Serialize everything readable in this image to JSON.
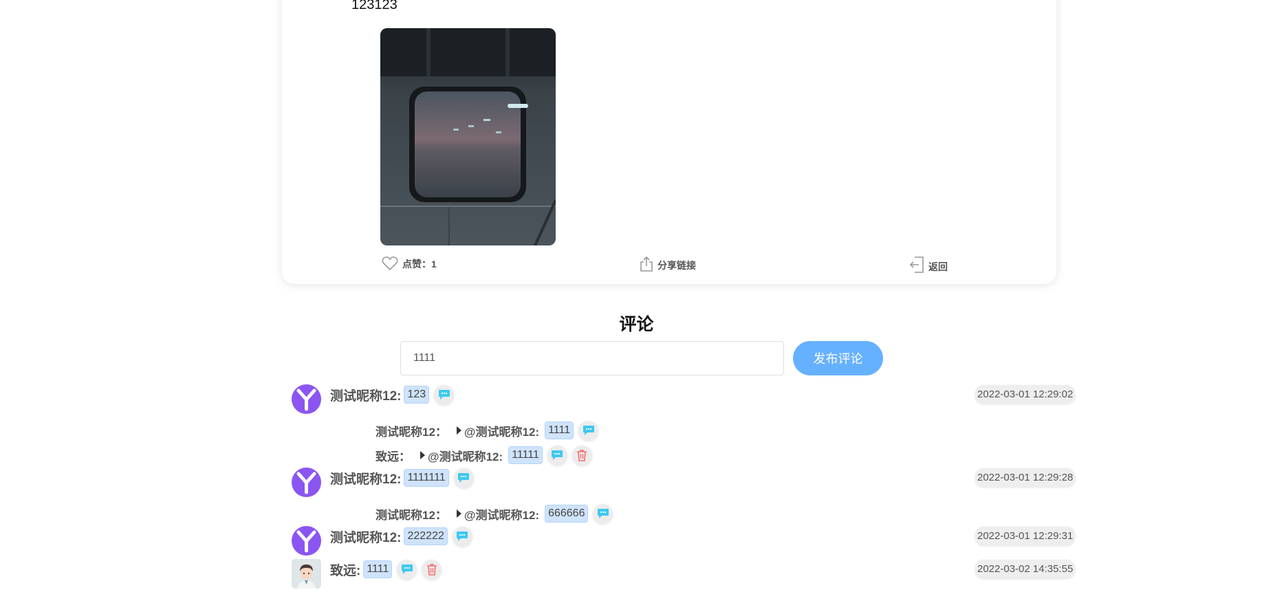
{
  "post": {
    "text": "123123",
    "actions": {
      "like_label": "点赞：1",
      "share_label": "分享链接",
      "back_label": "返回"
    }
  },
  "comments_section": {
    "title": "评论",
    "input_value": "1111",
    "submit_label": "发布评论"
  },
  "comments": [
    {
      "name": "测试昵称12:",
      "content": "123",
      "time": "2022-03-01 12:29:02",
      "replies": [
        {
          "from": "测试昵称12：",
          "to": "@测试昵称12:",
          "content": "1111",
          "deletable": false
        },
        {
          "from": "致远：",
          "to": "@测试昵称12:",
          "content": "11111",
          "deletable": true
        }
      ]
    },
    {
      "name": "测试昵称12:",
      "content": "1111111",
      "time": "2022-03-01 12:29:28",
      "replies": [
        {
          "from": "测试昵称12：",
          "to": "@测试昵称12:",
          "content": "666666",
          "deletable": false
        }
      ]
    },
    {
      "name": "测试昵称12:",
      "content": "222222",
      "time": "2022-03-01 12:29:31",
      "replies": []
    },
    {
      "name": "致远:",
      "content": "1111",
      "time": "2022-03-02 14:35:55",
      "replies": [],
      "deletable": true
    }
  ],
  "icons": {
    "reply": "comment-bubble-icon",
    "delete": "trash-icon",
    "like": "heart-icon",
    "share": "share-icon",
    "back": "exit-icon"
  },
  "colors": {
    "accent": "#66b1ff",
    "avatar_purple": "#8b55f2",
    "reply_icon": "#3ec9f0",
    "delete_icon": "#f56c6c",
    "bubble_bg": "#cfe3fb"
  }
}
